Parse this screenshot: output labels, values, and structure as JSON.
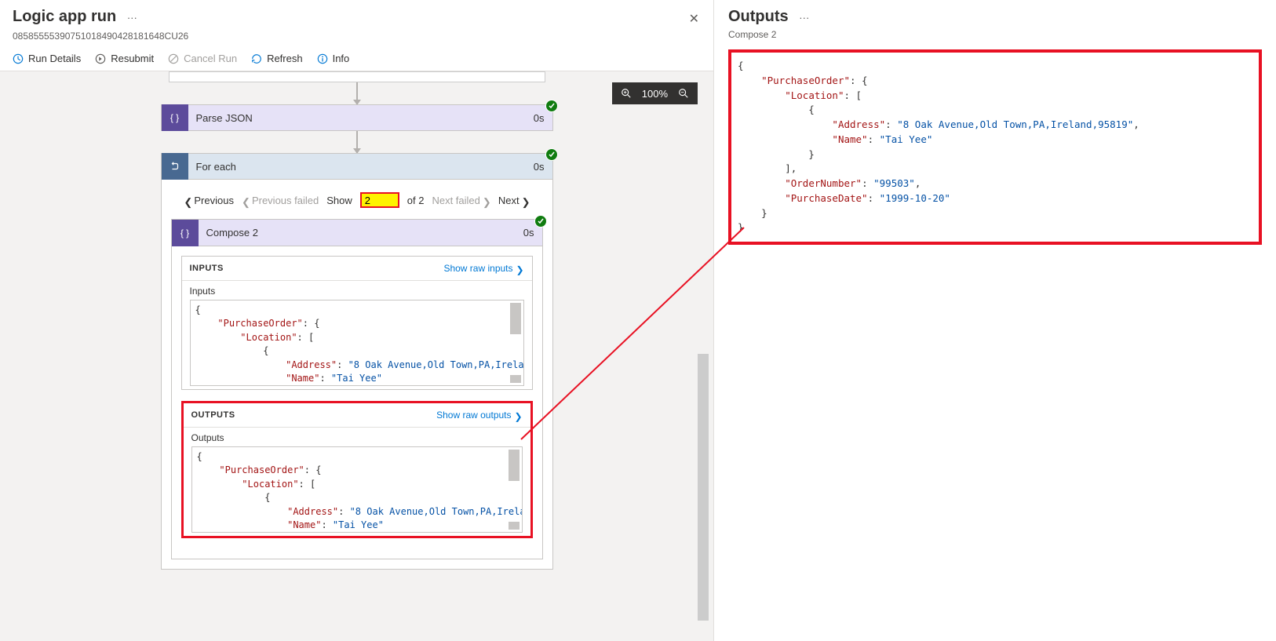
{
  "left": {
    "title": "Logic app run",
    "run_id": "08585555390751018490428181648CU26",
    "toolbar": {
      "run_details": "Run Details",
      "resubmit": "Resubmit",
      "cancel_run": "Cancel Run",
      "refresh": "Refresh",
      "info": "Info"
    },
    "zoom": "100%",
    "steps": {
      "parse_json": {
        "title": "Parse JSON",
        "time": "0s"
      },
      "for_each": {
        "title": "For each",
        "time": "0s"
      },
      "compose2": {
        "title": "Compose 2",
        "time": "0s"
      }
    },
    "pager": {
      "previous": "Previous",
      "previous_failed": "Previous failed",
      "show": "Show",
      "page_value": "2",
      "of_total": "of 2",
      "next_failed": "Next failed",
      "next": "Next"
    },
    "sections": {
      "inputs_title": "INPUTS",
      "inputs_link": "Show raw inputs",
      "inputs_label": "Inputs",
      "outputs_title": "OUTPUTS",
      "outputs_link": "Show raw outputs",
      "outputs_label": "Outputs"
    },
    "json_preview": {
      "address_key": "\"Address\"",
      "address_val": "\"8 Oak Avenue,Old Town,PA,Ireland,95819\"",
      "name_key": "\"Name\"",
      "name_val": "\"Tai Yee\""
    }
  },
  "right": {
    "title": "Outputs",
    "subtitle": "Compose 2",
    "json": {
      "po": "\"PurchaseOrder\"",
      "loc": "\"Location\"",
      "address_key": "\"Address\"",
      "address_val": "\"8 Oak Avenue,Old Town,PA,Ireland,95819\"",
      "name_key": "\"Name\"",
      "name_val": "\"Tai Yee\"",
      "order_key": "\"OrderNumber\"",
      "order_val": "\"99503\"",
      "date_key": "\"PurchaseDate\"",
      "date_val": "\"1999-10-20\""
    }
  }
}
